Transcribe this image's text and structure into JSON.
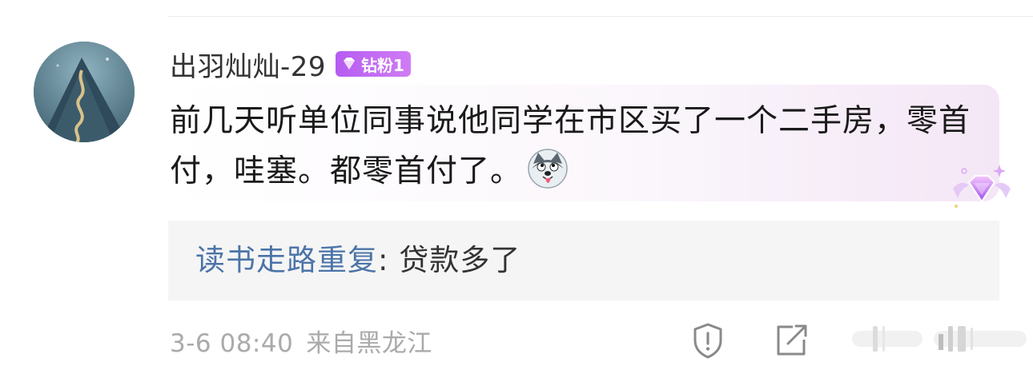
{
  "comment": {
    "username": "出羽灿灿-29",
    "badge_label": "钻粉1",
    "text": "前几天听单位同事说他同学在市区买了一个二手房，零首付，哇塞。都零首付了。",
    "emoji": "husky-dog-emoji"
  },
  "reply": {
    "user": "读书走路重复",
    "separator": ": ",
    "text": "贷款多了"
  },
  "meta": {
    "time": "3-6 08:40",
    "location": "来自黑龙江"
  },
  "actions": [
    "report-icon",
    "share-icon",
    "comment-icon",
    "like-icon"
  ],
  "colors": {
    "badge": "#b65cf2",
    "reply_user": "#4b74a8",
    "meta": "#aaaaaa"
  }
}
